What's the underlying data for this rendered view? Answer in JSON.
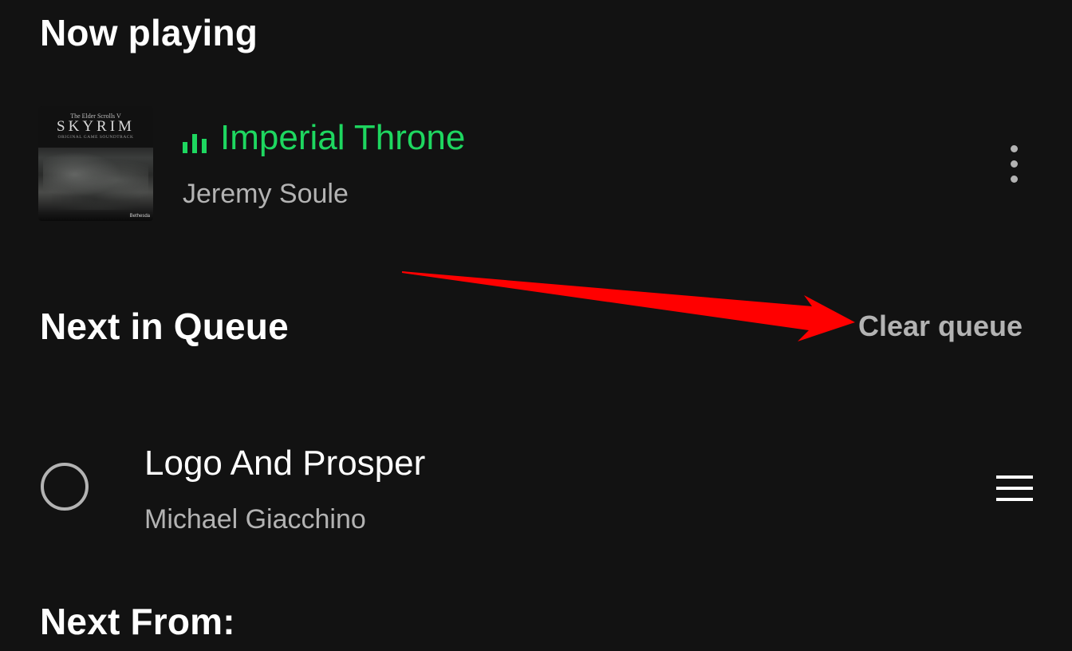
{
  "now_playing": {
    "section_title": "Now playing",
    "track": {
      "title": "Imperial Throne",
      "artist": "Jeremy Soule",
      "album_art": {
        "small_text": "The Elder Scrolls V",
        "title_text": "SKYRIM",
        "subtitle_text": "ORIGINAL GAME SOUNDTRACK",
        "footer_text": "Bethesda"
      },
      "playing_indicator_icon": "equalizer-bars-icon",
      "more_icon": "more-vertical-icon"
    }
  },
  "queue": {
    "section_title": "Next in Queue",
    "clear_label": "Clear queue",
    "items": [
      {
        "title": "Logo And Prosper",
        "artist": "Michael Giacchino",
        "select_icon": "radio-circle-icon",
        "drag_icon": "drag-handle-icon"
      }
    ]
  },
  "next_from": {
    "section_title": "Next From:"
  },
  "annotation": {
    "arrow_color": "#ff0000"
  },
  "colors": {
    "background": "#121212",
    "accent": "#1ed760",
    "primary_text": "#ffffff",
    "secondary_text": "#b3b3b3"
  }
}
